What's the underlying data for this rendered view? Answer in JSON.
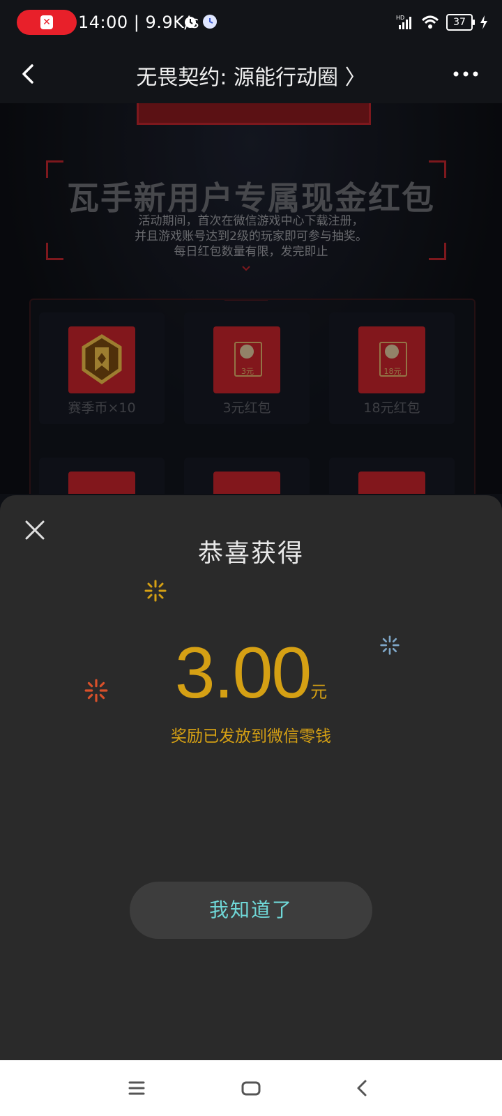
{
  "status_bar": {
    "time_speed": "14:00 | 9.9K/s",
    "network": "HD",
    "battery": "37"
  },
  "titlebar": {
    "title": "无畏契约: 源能行动圈 〉"
  },
  "background_page": {
    "promo_title": "瓦手新用户专属现金红包",
    "promo_desc_lines": [
      "活动期间，首次在微信游戏中心下载注册，",
      "并且游戏账号达到2级的玩家即可参与抽奖。",
      "每日红包数量有限，发完即止"
    ],
    "rewards": [
      {
        "label": "赛季币×10",
        "icon": "season-coin-icon"
      },
      {
        "label": "3元红包",
        "icon": "red-packet-icon",
        "badge": "3元"
      },
      {
        "label": "18元红包",
        "icon": "red-packet-icon",
        "badge": "18元"
      }
    ]
  },
  "dialog": {
    "title": "恭喜获得",
    "amount": "3.00",
    "unit": "元",
    "message": "奖励已发放到微信零钱",
    "confirm_label": "我知道了"
  },
  "colors": {
    "accent_gold": "#d5a014",
    "button_text": "#6fd7d7",
    "brand_red": "#c8242b"
  }
}
